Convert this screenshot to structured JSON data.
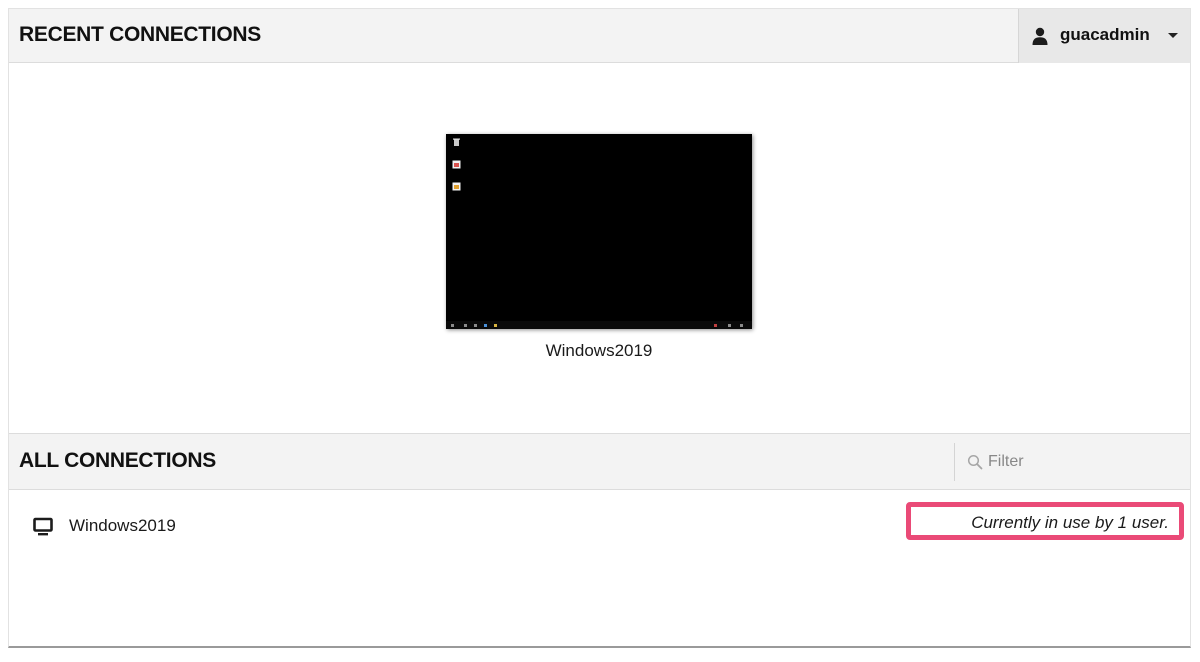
{
  "recent": {
    "title": "RECENT CONNECTIONS",
    "tiles": [
      {
        "name": "Windows2019"
      }
    ]
  },
  "user_menu": {
    "username": "guacadmin",
    "user_icon": "user-icon",
    "caret_icon": "caret-down-icon"
  },
  "all": {
    "title": "ALL CONNECTIONS",
    "filter": {
      "placeholder": "Filter",
      "value": "",
      "icon": "search-icon"
    },
    "connections": [
      {
        "name": "Windows2019",
        "icon": "monitor-icon",
        "status": "Currently in use by 1 user."
      }
    ]
  },
  "colors": {
    "header_bg": "#f3f3f3",
    "user_menu_bg": "#e8e8e8",
    "highlight_border": "#ea4a77"
  }
}
